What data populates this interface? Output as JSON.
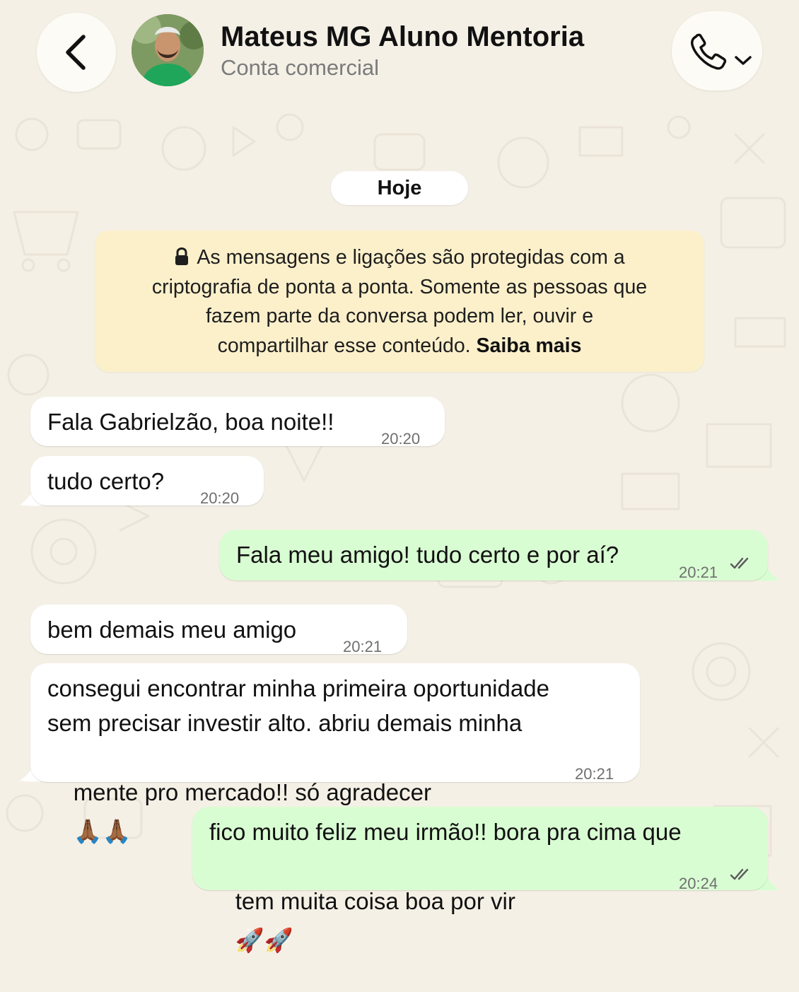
{
  "header": {
    "contact_name": "Mateus MG Aluno Mentoria",
    "contact_subtitle": "Conta comercial",
    "back_icon": "chevron-left-icon",
    "call_icon": "phone-icon"
  },
  "chat": {
    "date_label": "Hoje",
    "encryption_notice": {
      "line1": "As mensagens e ligações são protegidas com a",
      "line2": "criptografia de ponta a ponta. Somente as pessoas que",
      "line3": "fazem parte da conversa podem ler, ouvir e",
      "line4_prefix": "compartilhar esse conteúdo.",
      "link": "Saiba mais"
    },
    "messages": [
      {
        "direction": "incoming",
        "lines": [
          "Fala Gabrielzão, boa noite!!"
        ],
        "time": "20:20"
      },
      {
        "direction": "incoming",
        "lines": [
          "tudo certo?"
        ],
        "time": "20:20"
      },
      {
        "direction": "outgoing",
        "lines": [
          "Fala meu amigo! tudo certo e por aí?"
        ],
        "time": "20:21",
        "status": "read"
      },
      {
        "direction": "incoming",
        "lines": [
          "bem demais meu amigo"
        ],
        "time": "20:21"
      },
      {
        "direction": "incoming",
        "lines": [
          "consegui encontrar minha primeira oportunidade",
          "sem precisar investir alto. abriu demais minha",
          "mente pro mercado!! só agradecer"
        ],
        "emoji": "🙏🏾🙏🏾",
        "time": "20:21"
      },
      {
        "direction": "outgoing",
        "lines": [
          "fico muito feliz meu irmão!! bora pra cima que",
          "tem muita coisa boa por vir"
        ],
        "emoji": "🚀🚀",
        "time": "20:24",
        "status": "read"
      }
    ]
  },
  "colors": {
    "background": "#f5f0e6",
    "incoming_bubble": "#ffffff",
    "outgoing_bubble": "#d9fdd3",
    "notice_bubble": "#fcf0cb",
    "read_ticks": "#5a5a5a"
  }
}
